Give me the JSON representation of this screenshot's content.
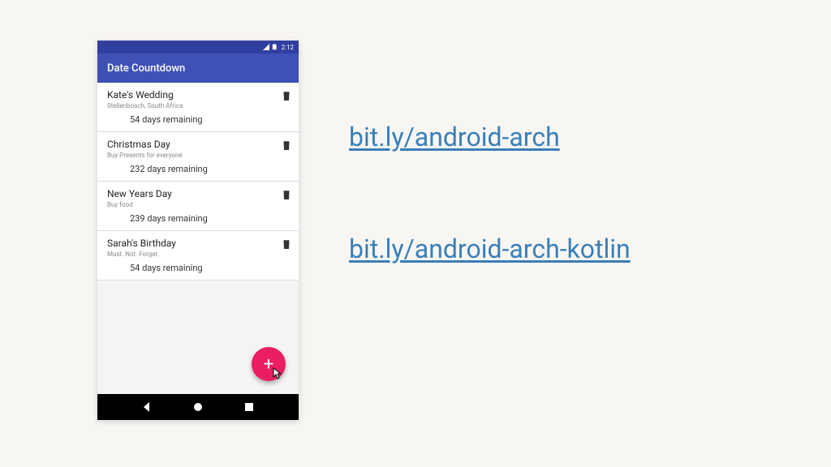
{
  "status_bar": {
    "time": "2:12"
  },
  "app_bar": {
    "title": "Date Countdown"
  },
  "events": [
    {
      "title": "Kate's Wedding",
      "subtitle": "Stellenbosch, South Africa",
      "remaining": "54 days remaining"
    },
    {
      "title": "Christmas Day",
      "subtitle": "Buy Presents for everyone",
      "remaining": "232 days remaining"
    },
    {
      "title": "New Years Day",
      "subtitle": "Buy food",
      "remaining": "239 days remaining"
    },
    {
      "title": "Sarah's Birthday",
      "subtitle": "Must. Not. Forget.",
      "remaining": "54 days remaining"
    }
  ],
  "fab": {
    "label": "+"
  },
  "links": {
    "link1": "bit.ly/android-arch",
    "link2": "bit.ly/android-arch-kotlin"
  }
}
